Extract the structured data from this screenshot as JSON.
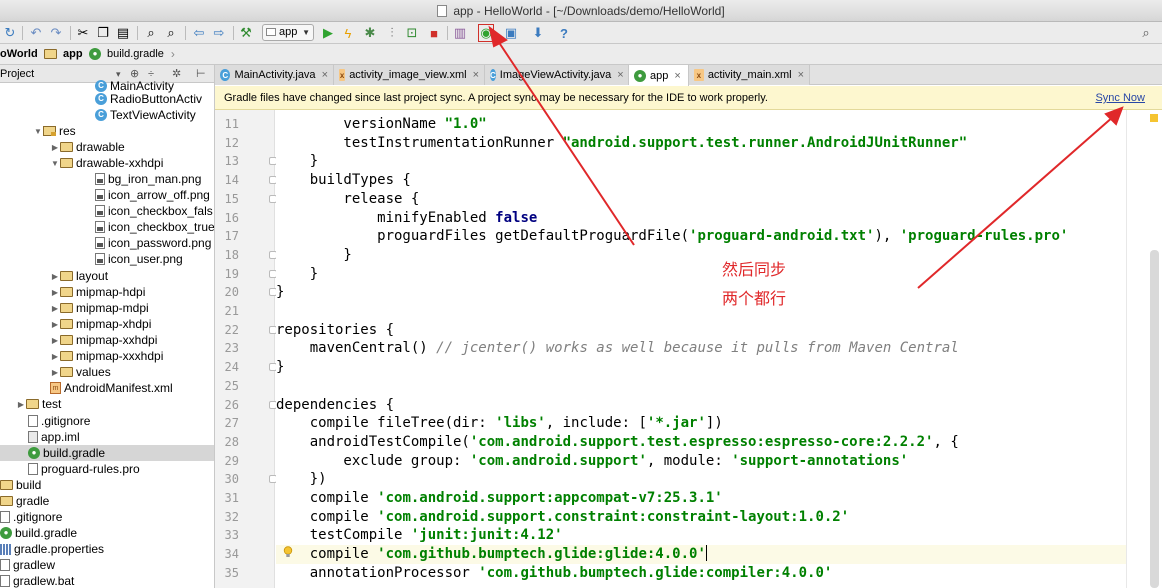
{
  "window": {
    "title": "app - HelloWorld - [~/Downloads/demo/HelloWorld]"
  },
  "toolbar": {
    "run_config": "app",
    "search_icon": "search-icon"
  },
  "breadcrumb": {
    "project": "oWorld",
    "module": "app",
    "file": "build.gradle"
  },
  "project_panel": {
    "header": "Project",
    "items": [
      {
        "label": "MainActivity",
        "icon": "class-icon"
      },
      {
        "label": "RadioButtonActiv",
        "icon": "class-icon"
      },
      {
        "label": "TextViewActivity",
        "icon": "class-icon"
      },
      {
        "label": "res",
        "icon": "res-folder-icon"
      },
      {
        "label": "drawable",
        "icon": "folder-icon"
      },
      {
        "label": "drawable-xxhdpi",
        "icon": "folder-icon"
      },
      {
        "label": "bg_iron_man.png",
        "icon": "image-file-icon"
      },
      {
        "label": "icon_arrow_off.png",
        "icon": "image-file-icon"
      },
      {
        "label": "icon_checkbox_fals",
        "icon": "image-file-icon"
      },
      {
        "label": "icon_checkbox_true",
        "icon": "image-file-icon"
      },
      {
        "label": "icon_password.png",
        "icon": "image-file-icon"
      },
      {
        "label": "icon_user.png",
        "icon": "image-file-icon"
      },
      {
        "label": "layout",
        "icon": "folder-icon"
      },
      {
        "label": "mipmap-hdpi",
        "icon": "folder-icon"
      },
      {
        "label": "mipmap-mdpi",
        "icon": "folder-icon"
      },
      {
        "label": "mipmap-xhdpi",
        "icon": "folder-icon"
      },
      {
        "label": "mipmap-xxhdpi",
        "icon": "folder-icon"
      },
      {
        "label": "mipmap-xxxhdpi",
        "icon": "folder-icon"
      },
      {
        "label": "values",
        "icon": "folder-icon"
      },
      {
        "label": "AndroidManifest.xml",
        "icon": "manifest-icon"
      },
      {
        "label": "test",
        "icon": "folder-icon"
      },
      {
        "label": ".gitignore",
        "icon": "file-icon"
      },
      {
        "label": "app.iml",
        "icon": "iml-file-icon"
      },
      {
        "label": "build.gradle",
        "icon": "gradle-icon"
      },
      {
        "label": "proguard-rules.pro",
        "icon": "file-icon"
      },
      {
        "label": "build",
        "icon": "folder-icon"
      },
      {
        "label": "gradle",
        "icon": "folder-icon"
      },
      {
        "label": ".gitignore",
        "icon": "file-icon"
      },
      {
        "label": "build.gradle",
        "icon": "gradle-icon"
      },
      {
        "label": "gradle.properties",
        "icon": "bars-icon"
      },
      {
        "label": "gradlew",
        "icon": "file-icon"
      },
      {
        "label": "gradlew.bat",
        "icon": "file-icon"
      }
    ]
  },
  "tabs": [
    {
      "label": "MainActivity.java"
    },
    {
      "label": "activity_image_view.xml"
    },
    {
      "label": "ImageViewActivity.java"
    },
    {
      "label": "app"
    },
    {
      "label": "activity_main.xml"
    }
  ],
  "banner": {
    "message": "Gradle files have changed since last project sync. A project sync may be necessary for the IDE to work properly.",
    "action": "Sync Now"
  },
  "editor": {
    "line_numbers": [
      "11",
      "12",
      "13",
      "14",
      "15",
      "16",
      "17",
      "18",
      "19",
      "20",
      "21",
      "22",
      "23",
      "24",
      "25",
      "26",
      "27",
      "28",
      "29",
      "30",
      "31",
      "32",
      "33",
      "34",
      "35"
    ],
    "lines": [
      "        versionName \"1.0\"",
      "        testInstrumentationRunner \"android.support.test.runner.AndroidJUnitRunner\"",
      "    }",
      "    buildTypes {",
      "        release {",
      "            minifyEnabled false",
      "            proguardFiles getDefaultProguardFile('proguard-android.txt'), 'proguard-rules.pro'",
      "        }",
      "    }",
      "}",
      "",
      "repositories {",
      "    mavenCentral() // jcenter() works as well because it pulls from Maven Central",
      "}",
      "",
      "dependencies {",
      "    compile fileTree(dir: 'libs', include: ['*.jar'])",
      "    androidTestCompile('com.android.support.test.espresso:espresso-core:2.2.2', {",
      "        exclude group: 'com.android.support', module: 'support-annotations'",
      "    })",
      "    compile 'com.android.support:appcompat-v7:25.3.1'",
      "    compile 'com.android.support.constraint:constraint-layout:1.0.2'",
      "    testCompile 'junit:junit:4.12'",
      "    compile 'com.github.bumptech.glide:glide:4.0.0'",
      "    annotationProcessor 'com.github.bumptech.glide:compiler:4.0.0'"
    ]
  },
  "annotation": {
    "line1": "然后同步",
    "line2": "两个都行",
    "color": "#e0282a"
  }
}
